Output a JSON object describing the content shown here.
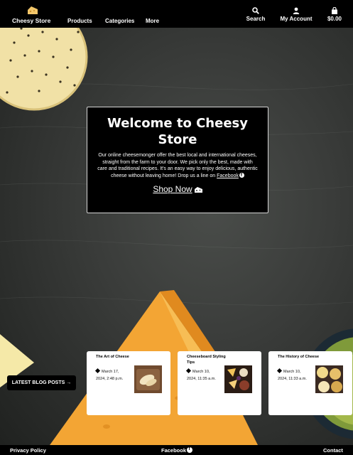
{
  "navbar": {
    "brand": "Cheesy Store",
    "links": [
      "Products",
      "Categories",
      "More"
    ],
    "search_label": "Search",
    "account_label": "My Account",
    "cart_label": "$0.00"
  },
  "hero": {
    "title": "Welcome to Cheesy Store",
    "text": "Our online cheesemonger offer the best local and international cheeses, straight from the farm to your door. We pick only the best, made with care and traditional recipes. It's an easy way to enjoy delicious, authentic cheese without leaving home! Drop us a line on",
    "facebook_link": "Facebook",
    "cta": "Shop Now"
  },
  "blog": {
    "button_label": "LATEST BLOG POSTS",
    "posts": [
      {
        "title": "The Art of Cheese",
        "date": "March 17, 2024, 2:48 p.m."
      },
      {
        "title": "Cheeseboard Styling Tips",
        "date": "March 10, 2024, 11:35 a.m."
      },
      {
        "title": "The History of Cheese",
        "date": "March 10, 2024, 11:33 a.m."
      }
    ]
  },
  "footer": {
    "privacy": "Privacy Policy",
    "facebook": "Facebook",
    "contact": "Contact"
  },
  "colors": {
    "navbar_bg": "#000000",
    "background": "#2e302e",
    "cheese": "#f3a534",
    "cracker": "#f1e1a6"
  }
}
